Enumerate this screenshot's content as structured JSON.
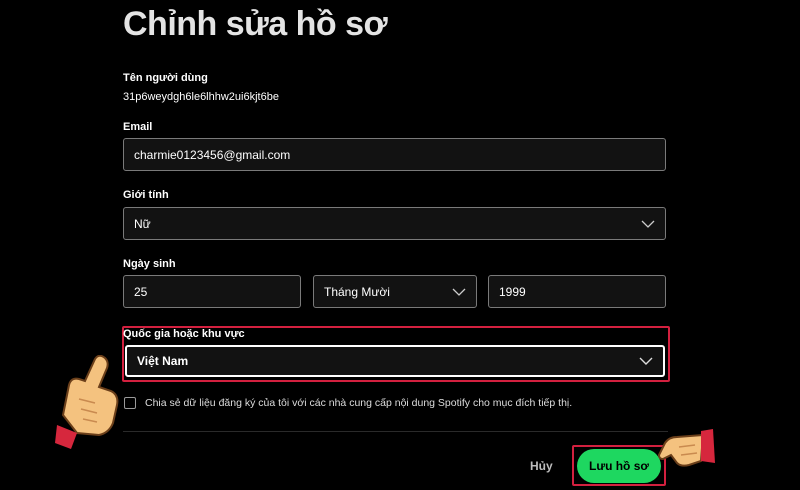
{
  "page": {
    "title": "Chỉnh sửa hồ sơ"
  },
  "username": {
    "label": "Tên người dùng",
    "value": "31p6weydgh6le6lhhw2ui6kjt6be"
  },
  "email": {
    "label": "Email",
    "value": "charmie0123456@gmail.com"
  },
  "gender": {
    "label": "Giới tính",
    "value": "Nữ"
  },
  "birthday": {
    "label": "Ngày sinh",
    "day": "25",
    "month": "Tháng Mười",
    "year": "1999"
  },
  "country": {
    "label": "Quốc gia hoặc khu vực",
    "value": "Việt Nam"
  },
  "share_data": {
    "label": "Chia sẻ dữ liệu đăng ký của tôi với các nhà cung cấp nội dung Spotify cho mục đích tiếp thị.",
    "checked": false
  },
  "actions": {
    "cancel_label": "Hủy",
    "save_label": "Lưu hồ sơ"
  },
  "colors": {
    "accent_green": "#1ed760",
    "highlight_red": "#d3203f",
    "field_bg": "#121212"
  },
  "icons": [
    "chevron-down-icon",
    "pointing-hand-icon"
  ]
}
